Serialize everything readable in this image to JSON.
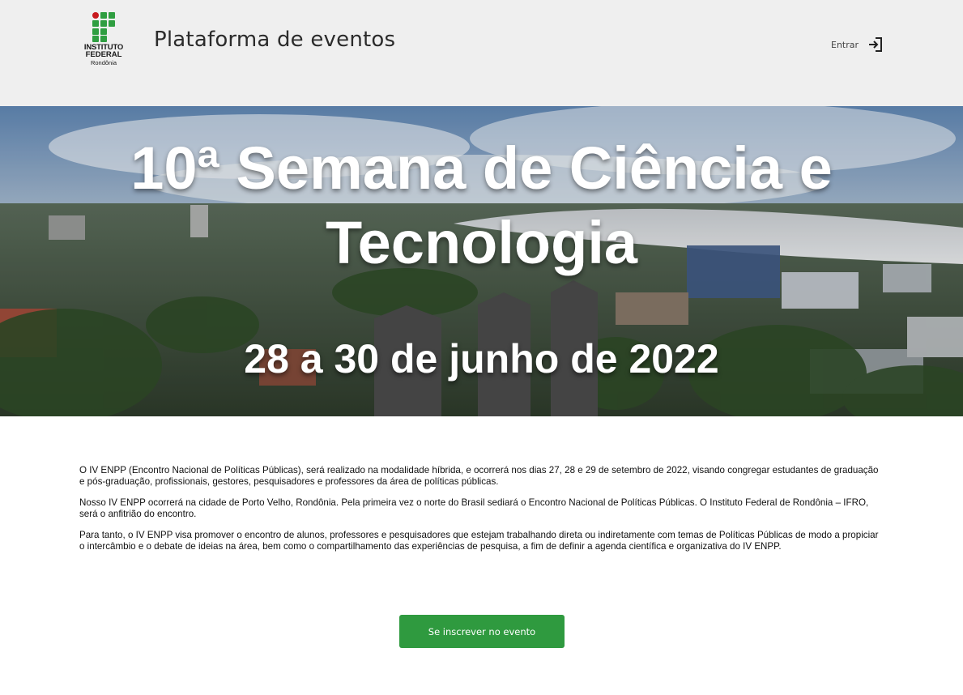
{
  "header": {
    "logo": {
      "line1": "INSTITUTO",
      "line2": "FEDERAL",
      "line3": "Rondônia",
      "colors": {
        "green": "#2f9e41",
        "red": "#c8191e"
      }
    },
    "title": "Plataforma de eventos",
    "login_label": "Entrar",
    "login_icon": "login-icon"
  },
  "banner": {
    "title": "10ª Semana de Ciência e Tecnologia",
    "date": "28 a 30 de junho de 2022",
    "image": "aerial-city-river-photo"
  },
  "content": {
    "paragraphs": [
      "O IV ENPP (Encontro Nacional de Políticas Públicas), será realizado na modalidade híbrida, e ocorrerá nos dias 27, 28 e 29 de setembro de 2022, visando congregar estudantes de graduação e pós-graduação, profissionais, gestores, pesquisadores e professores da área de políticas públicas.",
      "Nosso IV ENPP ocorrerá na cidade de Porto Velho, Rondônia. Pela primeira vez o norte do Brasil sediará o Encontro Nacional de Políticas Públicas. O Instituto Federal de Rondônia – IFRO, será o anfitrião do encontro.",
      "Para tanto, o IV ENPP visa promover o encontro de alunos, professores e pesquisadores que estejam trabalhando direta ou indiretamente com temas de Políticas Públicas de modo a propiciar o intercâmbio e o debate de ideias na área, bem como o compartilhamento das experiências de pesquisa, a fim de definir a agenda científica e organizativa do IV ENPP."
    ]
  },
  "cta": {
    "label": "Se inscrever no evento",
    "color": "#2f9a3f"
  }
}
